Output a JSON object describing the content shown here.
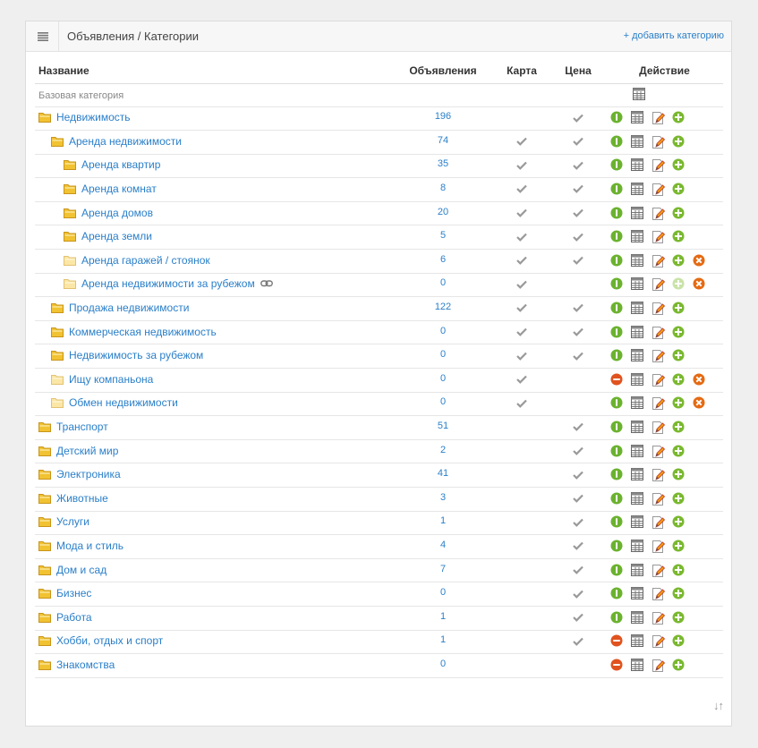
{
  "header": {
    "title": "Объявления / Категории",
    "add_link": "+ добавить категорию"
  },
  "columns": {
    "name": "Название",
    "count": "Объявления",
    "map": "Карта",
    "price": "Цена",
    "action": "Действие"
  },
  "base_row": {
    "label": "Базовая категория"
  },
  "rows": [
    {
      "name": "Недвижимость",
      "level": 0,
      "count": "196",
      "map": false,
      "price": true,
      "enabled": true,
      "folder": "full",
      "del": false,
      "add_dim": false
    },
    {
      "name": "Аренда недвижимости",
      "level": 1,
      "count": "74",
      "map": true,
      "price": true,
      "enabled": true,
      "folder": "full",
      "del": false,
      "add_dim": false
    },
    {
      "name": "Аренда квартир",
      "level": 2,
      "count": "35",
      "map": true,
      "price": true,
      "enabled": true,
      "folder": "full",
      "del": false,
      "add_dim": false
    },
    {
      "name": "Аренда комнат",
      "level": 2,
      "count": "8",
      "map": true,
      "price": true,
      "enabled": true,
      "folder": "full",
      "del": false,
      "add_dim": false
    },
    {
      "name": "Аренда домов",
      "level": 2,
      "count": "20",
      "map": true,
      "price": true,
      "enabled": true,
      "folder": "full",
      "del": false,
      "add_dim": false
    },
    {
      "name": "Аренда земли",
      "level": 2,
      "count": "5",
      "map": true,
      "price": true,
      "enabled": true,
      "folder": "full",
      "del": false,
      "add_dim": false
    },
    {
      "name": "Аренда гаражей / стоянок",
      "level": 2,
      "count": "6",
      "map": true,
      "price": true,
      "enabled": true,
      "folder": "empty",
      "del": true,
      "add_dim": false
    },
    {
      "name": "Аренда недвижимости за рубежом",
      "level": 2,
      "count": "0",
      "map": true,
      "price": false,
      "enabled": true,
      "folder": "empty",
      "del": true,
      "add_dim": true,
      "link": true
    },
    {
      "name": "Продажа недвижимости",
      "level": 1,
      "count": "122",
      "map": true,
      "price": true,
      "enabled": true,
      "folder": "full",
      "del": false,
      "add_dim": false
    },
    {
      "name": "Коммерческая недвижимость",
      "level": 1,
      "count": "0",
      "map": true,
      "price": true,
      "enabled": true,
      "folder": "full",
      "del": false,
      "add_dim": false
    },
    {
      "name": "Недвижимость за рубежом",
      "level": 1,
      "count": "0",
      "map": true,
      "price": true,
      "enabled": true,
      "folder": "full",
      "del": false,
      "add_dim": false
    },
    {
      "name": "Ищу компаньона",
      "level": 1,
      "count": "0",
      "map": true,
      "price": false,
      "enabled": false,
      "folder": "empty",
      "del": true,
      "add_dim": false
    },
    {
      "name": "Обмен недвижимости",
      "level": 1,
      "count": "0",
      "map": true,
      "price": false,
      "enabled": true,
      "folder": "empty",
      "del": true,
      "add_dim": false
    },
    {
      "name": "Транспорт",
      "level": 0,
      "count": "51",
      "map": false,
      "price": true,
      "enabled": true,
      "folder": "full",
      "del": false,
      "add_dim": false
    },
    {
      "name": "Детский мир",
      "level": 0,
      "count": "2",
      "map": false,
      "price": true,
      "enabled": true,
      "folder": "full",
      "del": false,
      "add_dim": false
    },
    {
      "name": "Электроника",
      "level": 0,
      "count": "41",
      "map": false,
      "price": true,
      "enabled": true,
      "folder": "full",
      "del": false,
      "add_dim": false
    },
    {
      "name": "Животные",
      "level": 0,
      "count": "3",
      "map": false,
      "price": true,
      "enabled": true,
      "folder": "full",
      "del": false,
      "add_dim": false
    },
    {
      "name": "Услуги",
      "level": 0,
      "count": "1",
      "map": false,
      "price": true,
      "enabled": true,
      "folder": "full",
      "del": false,
      "add_dim": false
    },
    {
      "name": "Мода и стиль",
      "level": 0,
      "count": "4",
      "map": false,
      "price": true,
      "enabled": true,
      "folder": "full",
      "del": false,
      "add_dim": false
    },
    {
      "name": "Дом и сад",
      "level": 0,
      "count": "7",
      "map": false,
      "price": true,
      "enabled": true,
      "folder": "full",
      "del": false,
      "add_dim": false
    },
    {
      "name": "Бизнес",
      "level": 0,
      "count": "0",
      "map": false,
      "price": true,
      "enabled": true,
      "folder": "full",
      "del": false,
      "add_dim": false
    },
    {
      "name": "Работа",
      "level": 0,
      "count": "1",
      "map": false,
      "price": true,
      "enabled": true,
      "folder": "full",
      "del": false,
      "add_dim": false
    },
    {
      "name": "Хобби, отдых и спорт",
      "level": 0,
      "count": "1",
      "map": false,
      "price": true,
      "enabled": false,
      "folder": "full",
      "del": false,
      "add_dim": false
    },
    {
      "name": "Знакомства",
      "level": 0,
      "count": "0",
      "map": false,
      "price": false,
      "enabled": false,
      "folder": "full",
      "del": false,
      "add_dim": false
    }
  ],
  "icons": {
    "menu": "menu-icon",
    "folder": "folder-icon",
    "check": "check-icon",
    "enable": "enable-icon",
    "disable": "disable-icon",
    "grid": "dynprops-icon",
    "edit": "edit-icon",
    "add": "add-subcategory-icon",
    "delete": "delete-icon",
    "link": "link-icon",
    "sort": "sort-icon"
  },
  "colors": {
    "link": "#2a7fc9",
    "enable": "#6bb22f",
    "disable": "#e0531f",
    "add": "#7ab830",
    "delete": "#e56a12",
    "folder": "#f1c232",
    "check": "#999999"
  },
  "footer": {
    "sort_glyph": "↓↑"
  }
}
